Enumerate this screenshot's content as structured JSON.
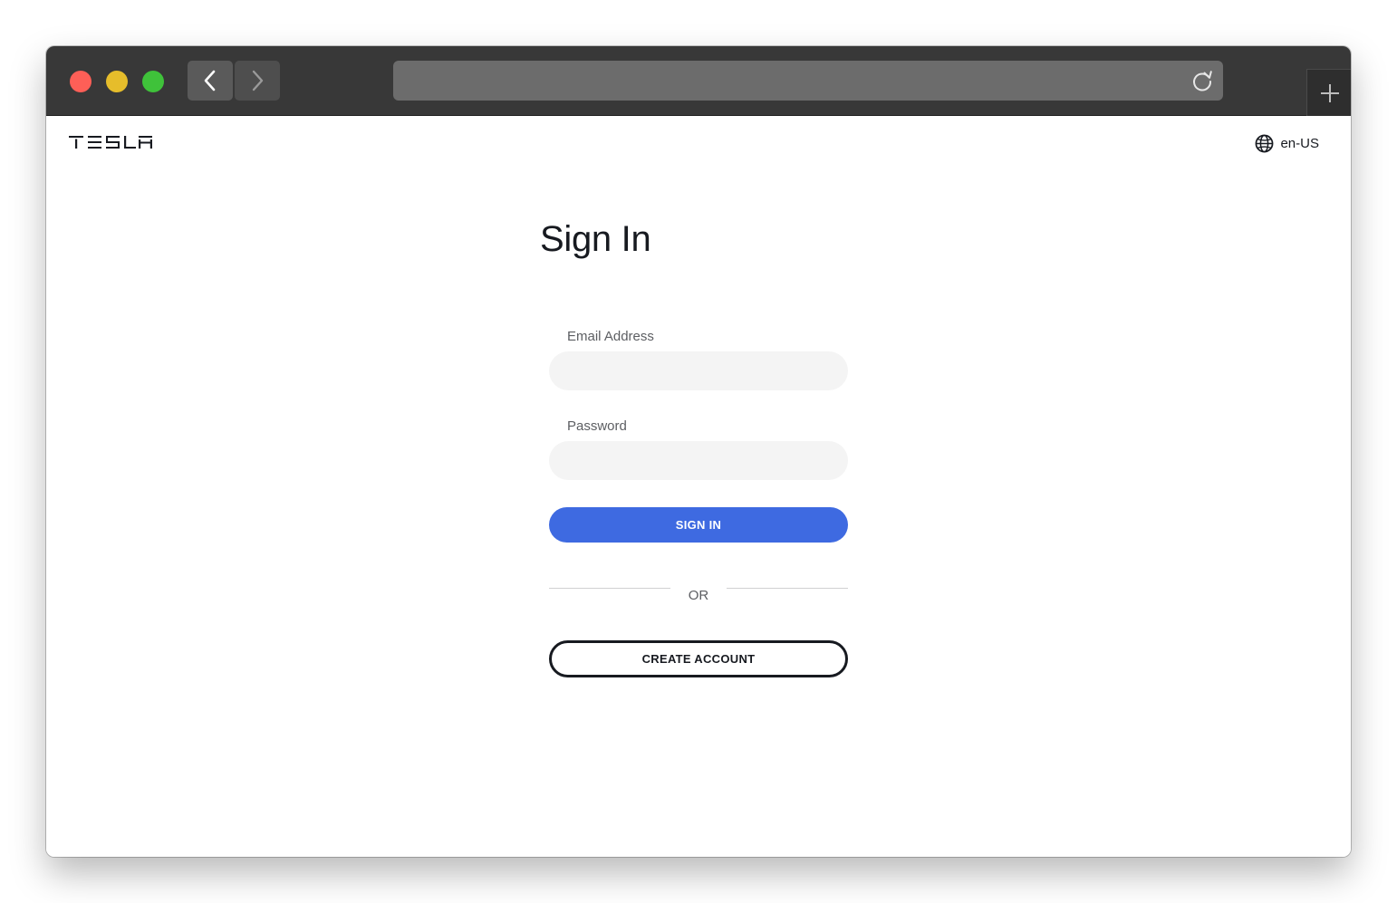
{
  "browser": {
    "back_icon": "chevron-left-icon",
    "forward_icon": "chevron-right-icon",
    "reload_icon": "reload-icon",
    "new_tab_icon": "plus-icon",
    "address": ""
  },
  "header": {
    "logo_text": "TESLA",
    "locale_icon": "globe-icon",
    "locale": "en-US"
  },
  "form": {
    "title": "Sign In",
    "email_label": "Email Address",
    "email_value": "",
    "password_label": "Password",
    "password_value": "",
    "sign_in_label": "SIGN IN",
    "divider_text": "OR",
    "create_account_label": "CREATE ACCOUNT"
  },
  "colors": {
    "primary": "#3e6ae1",
    "text": "#171a20",
    "muted": "#5c5e62",
    "input_bg": "#f4f4f4",
    "titlebar": "#383838"
  }
}
